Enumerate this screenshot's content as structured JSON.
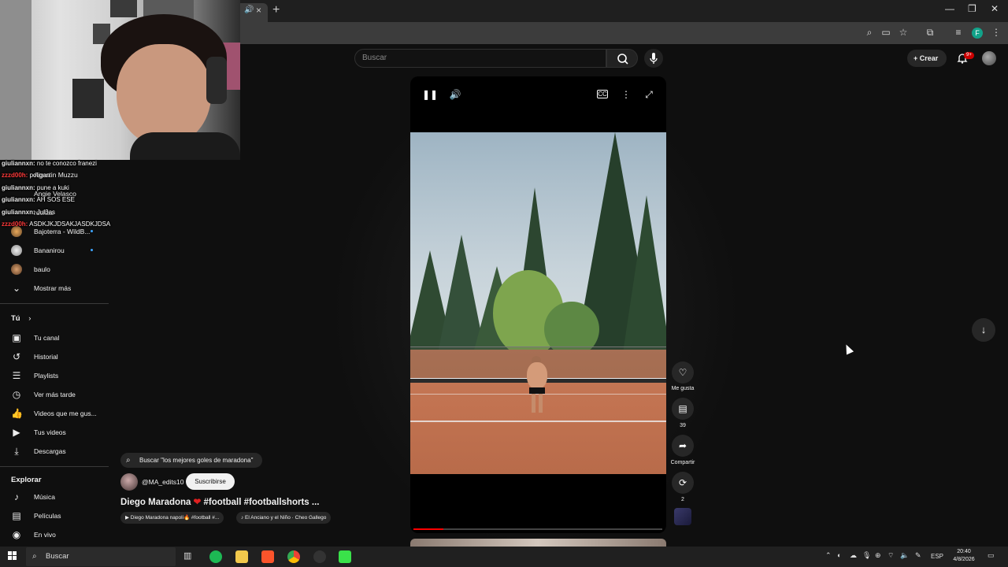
{
  "browser": {
    "tab_speaker_icon": "speaker-icon",
    "tab_close": "×",
    "new_tab": "+",
    "minimize": "—",
    "restore": "❐",
    "close": "✕",
    "profile_initial": "F"
  },
  "youtube_header": {
    "search_placeholder": "Buscar",
    "create_label": "Crear",
    "notifications_badge": "9+"
  },
  "stream_chat": [
    {
      "user": "giuliannxn:",
      "text": "no te conozco franezi"
    },
    {
      "user": "zzzd00h:",
      "text": "poligan"
    },
    {
      "user": "giuliannxn:",
      "text": "pune a kuki"
    },
    {
      "user": "giuliannxn:",
      "text": "AH SOS ESE"
    },
    {
      "user": "giuliannxn:",
      "text": "Jul3as"
    },
    {
      "user": "zzzd00h:",
      "text": "ASDKJKJDSAKJASDKJDSA"
    }
  ],
  "sidebar": {
    "subscriptions_partial": [
      {
        "label": "Agustin Muzzu"
      },
      {
        "label": "Angie Velasco"
      },
      {
        "label": "rdcitas"
      }
    ],
    "subscriptions": [
      {
        "label": "Bajoterra - WildB...",
        "dot": true
      },
      {
        "label": "Bananirou",
        "dot": true
      },
      {
        "label": "baulo",
        "dot": false
      }
    ],
    "show_more": "Mostrar más",
    "you_heading": "Tú",
    "you_items": [
      {
        "label": "Tu canal",
        "icon": "channel-icon"
      },
      {
        "label": "Historial",
        "icon": "history-icon"
      },
      {
        "label": "Playlists",
        "icon": "playlists-icon"
      },
      {
        "label": "Ver más tarde",
        "icon": "watch-later-icon"
      },
      {
        "label": "Videos que me gus...",
        "icon": "liked-icon"
      },
      {
        "label": "Tus videos",
        "icon": "your-videos-icon"
      },
      {
        "label": "Descargas",
        "icon": "download-icon"
      }
    ],
    "explore_heading": "Explorar",
    "explore_items": [
      {
        "label": "Música",
        "icon": "music-icon"
      },
      {
        "label": "Películas",
        "icon": "movies-icon"
      },
      {
        "label": "En vivo",
        "icon": "live-icon"
      }
    ]
  },
  "short": {
    "progress_fraction": 0.12,
    "actions": {
      "like_label": "Me gusta",
      "comments_count": "39",
      "share_label": "Compartir",
      "remix_count": "2"
    },
    "search_suggestion": "Buscar \"los mejores goles de maradona\"",
    "channel_handle": "@MA_edits10",
    "subscribe_label": "Suscribirse",
    "title_before": "Diego Maradona",
    "title_heart": "❤",
    "title_after": "#football #footballshorts ...",
    "chips": [
      "▶ Diego Maradona napoli🔥 #football #...",
      "♪ El Anciano y el Niño · Cheo Gallego"
    ]
  },
  "taskbar": {
    "search_label": "Buscar",
    "language": "ESP",
    "time": "20:40",
    "date": "4/8/2026"
  }
}
